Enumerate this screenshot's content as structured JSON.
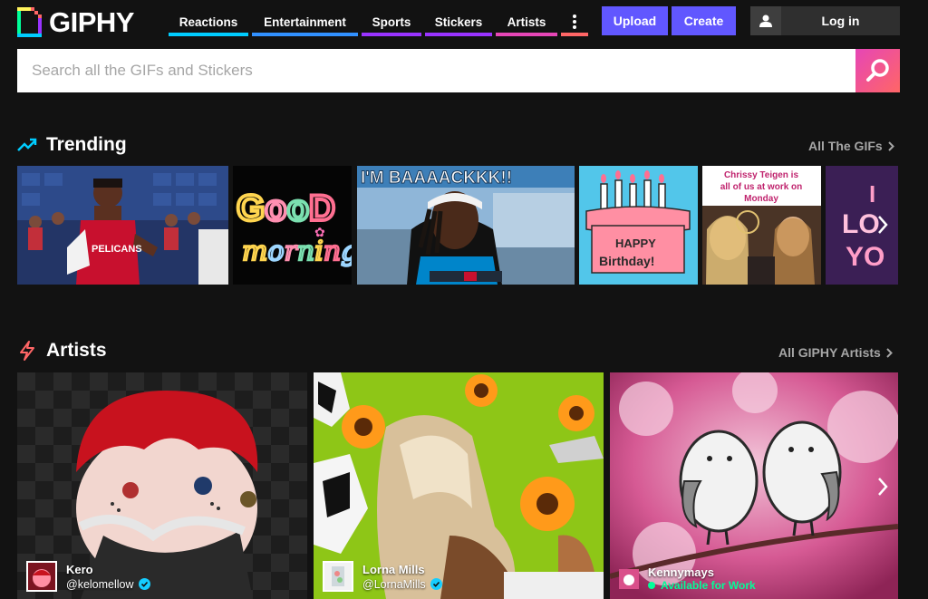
{
  "brand": {
    "name": "GIPHY"
  },
  "nav": {
    "items": [
      {
        "label": "Reactions",
        "color": "#00ccff"
      },
      {
        "label": "Entertainment",
        "color": "#3191ff"
      },
      {
        "label": "Sports",
        "color": "#9933ff"
      },
      {
        "label": "Stickers",
        "color": "#9933ff"
      },
      {
        "label": "Artists",
        "color": "#e646b6"
      }
    ],
    "more_icon": "more-vertical-icon",
    "more_color": "#ff6666"
  },
  "actions": {
    "upload_label": "Upload",
    "create_label": "Create",
    "login_label": "Log in",
    "accent": "#6157ff"
  },
  "search": {
    "placeholder": "Search all the GIFs and Stickers",
    "icon": "search-icon"
  },
  "trending": {
    "title": "Trending",
    "link_label": "All The GIFs",
    "icon": "trending-up-icon",
    "gifs": [
      {
        "name": "basketball-player"
      },
      {
        "name": "good-morning",
        "text": "GOOD morning"
      },
      {
        "name": "im-back",
        "text": "I'M BAAAACKKK!!"
      },
      {
        "name": "happy-birthday",
        "text": "HAPPY Birthday!"
      },
      {
        "name": "chrissy-teigen",
        "text": "Chrissy Teigen is all of us at work on Monday"
      },
      {
        "name": "i-love-you",
        "text": "I LO YO"
      }
    ]
  },
  "artists": {
    "title": "Artists",
    "link_label": "All GIPHY Artists",
    "icon": "lightning-icon",
    "cards": [
      {
        "name": "Kero",
        "handle": "@kelomellow",
        "verified": true
      },
      {
        "name": "Lorna Mills",
        "handle": "@LornaMills",
        "verified": true
      },
      {
        "name": "Kennymays",
        "status": "Available for Work"
      }
    ]
  }
}
